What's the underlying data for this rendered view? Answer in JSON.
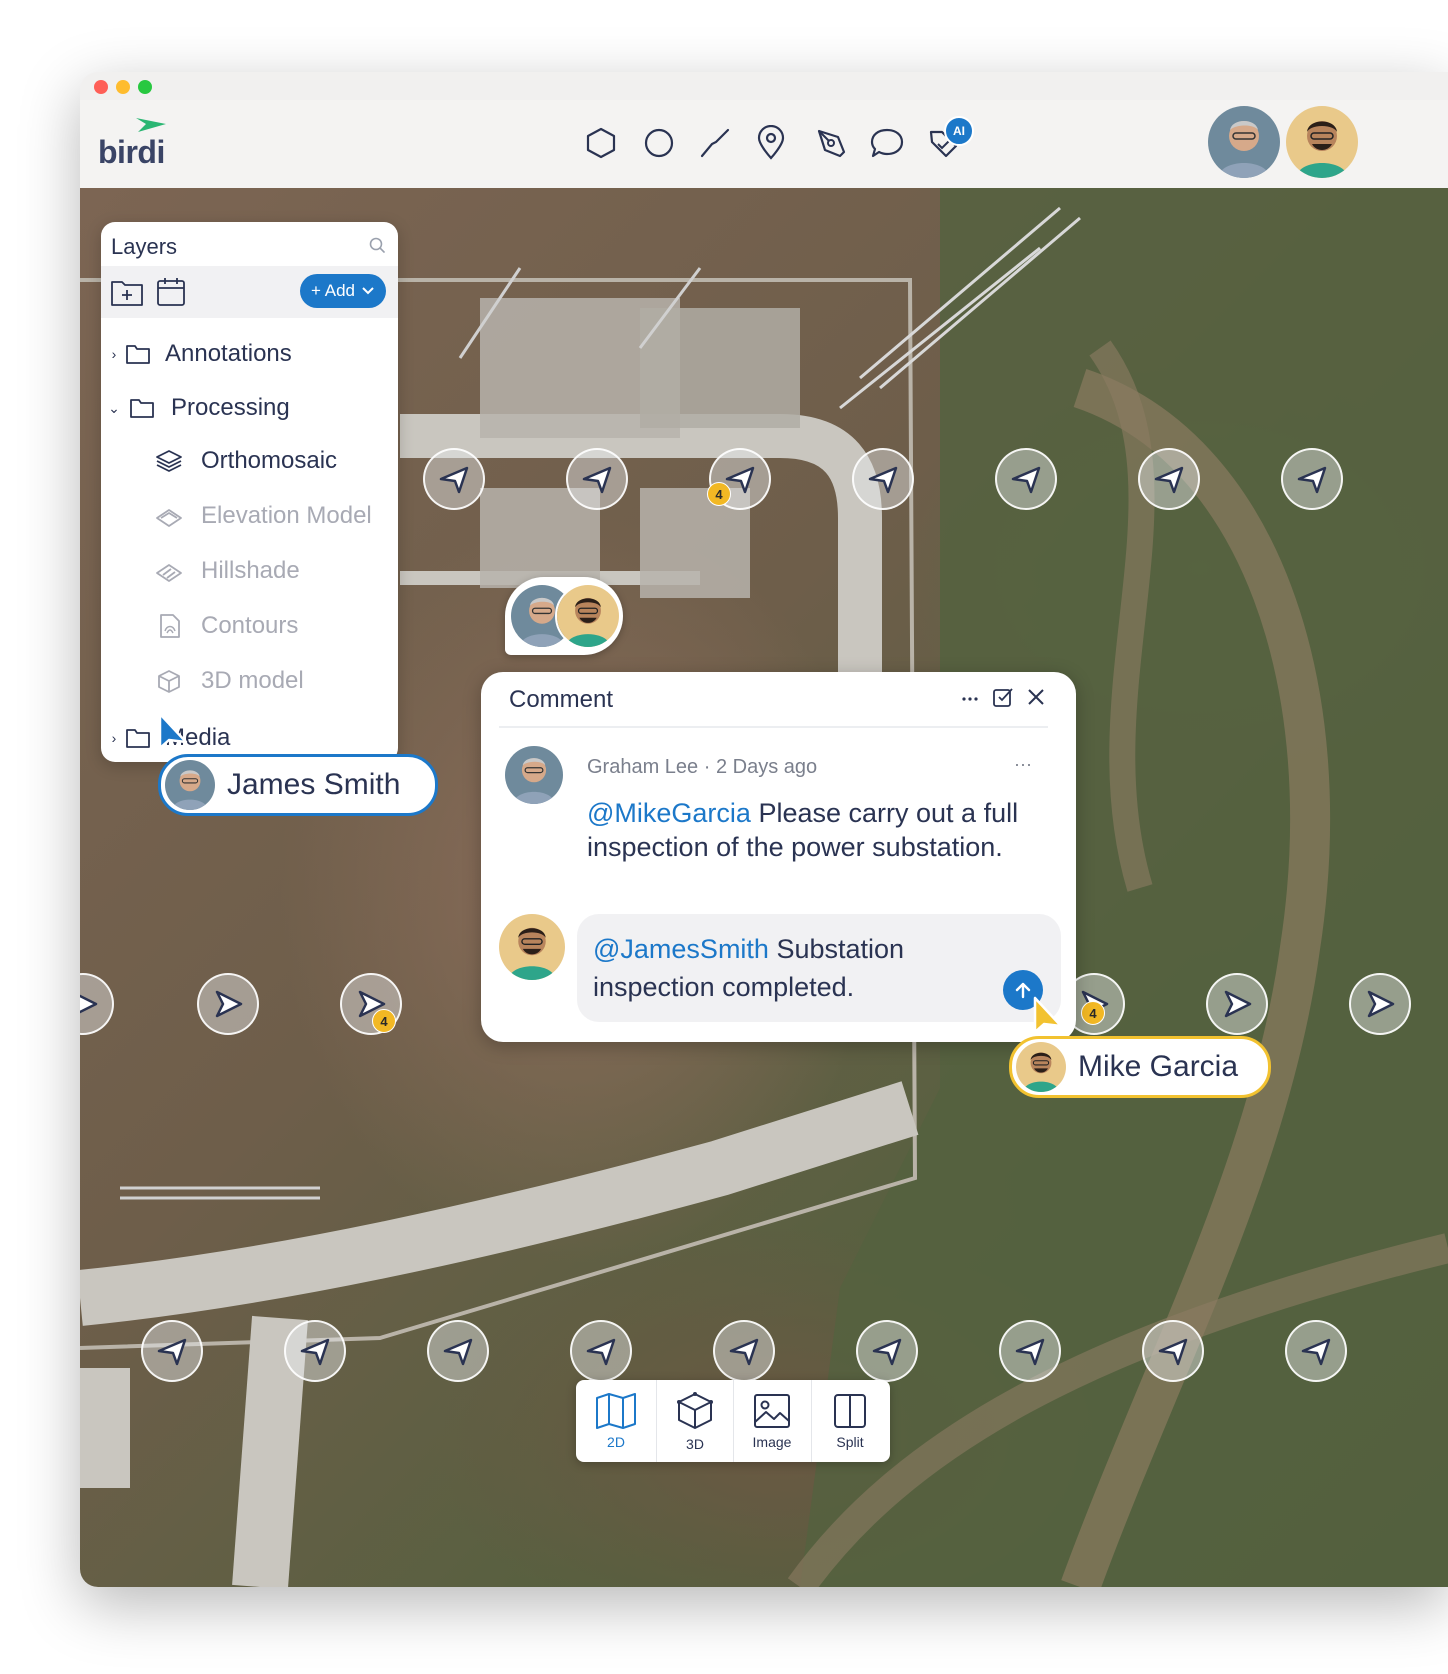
{
  "app": {
    "logo_text": "birdi",
    "ai_badge": "AI",
    "tools": [
      {
        "icon": "polygon-icon"
      },
      {
        "icon": "circle-icon"
      },
      {
        "icon": "line-icon"
      },
      {
        "icon": "location-pin-icon"
      },
      {
        "icon": "pen-icon"
      },
      {
        "icon": "comment-icon"
      },
      {
        "icon": "ai-tag-icon"
      }
    ]
  },
  "layers": {
    "title": "Layers",
    "add_label": "+ Add",
    "items": [
      {
        "label": "Annotations",
        "type": "folder",
        "expanded": false
      },
      {
        "label": "Processing",
        "type": "folder",
        "expanded": true
      },
      {
        "label": "Orthomosaic",
        "type": "layer",
        "active": true
      },
      {
        "label": "Elevation Model",
        "type": "layer",
        "active": false
      },
      {
        "label": "Hillshade",
        "type": "layer",
        "active": false
      },
      {
        "label": "Contours",
        "type": "layer",
        "active": false
      },
      {
        "label": "3D model",
        "type": "layer",
        "active": false
      },
      {
        "label": "Media",
        "type": "folder",
        "expanded": false
      }
    ]
  },
  "map": {
    "cluster_count": "4"
  },
  "comment": {
    "title": "Comment",
    "first": {
      "author_meta": "Graham Lee · 2 Days ago",
      "mention": "@MikeGarcia",
      "text": " Please carry out a full inspection of the power substation.",
      "more": "···"
    },
    "reply": {
      "mention": "@JamesSmith",
      "text": " Substation inspection completed."
    }
  },
  "cursors": {
    "james": {
      "name": "James Smith",
      "color": "#1c78c9"
    },
    "mike": {
      "name": "Mike Garcia",
      "color": "#f2c230"
    }
  },
  "views": [
    {
      "label": "2D",
      "icon": "map-icon",
      "active": true
    },
    {
      "label": "3D",
      "icon": "cube-icon",
      "active": false
    },
    {
      "label": "Image",
      "icon": "image-icon",
      "active": false
    },
    {
      "label": "Split",
      "icon": "split-icon",
      "active": false
    }
  ],
  "colors": {
    "accent": "#1c78c9",
    "badge": "#f2b824",
    "text": "#2a3352"
  }
}
